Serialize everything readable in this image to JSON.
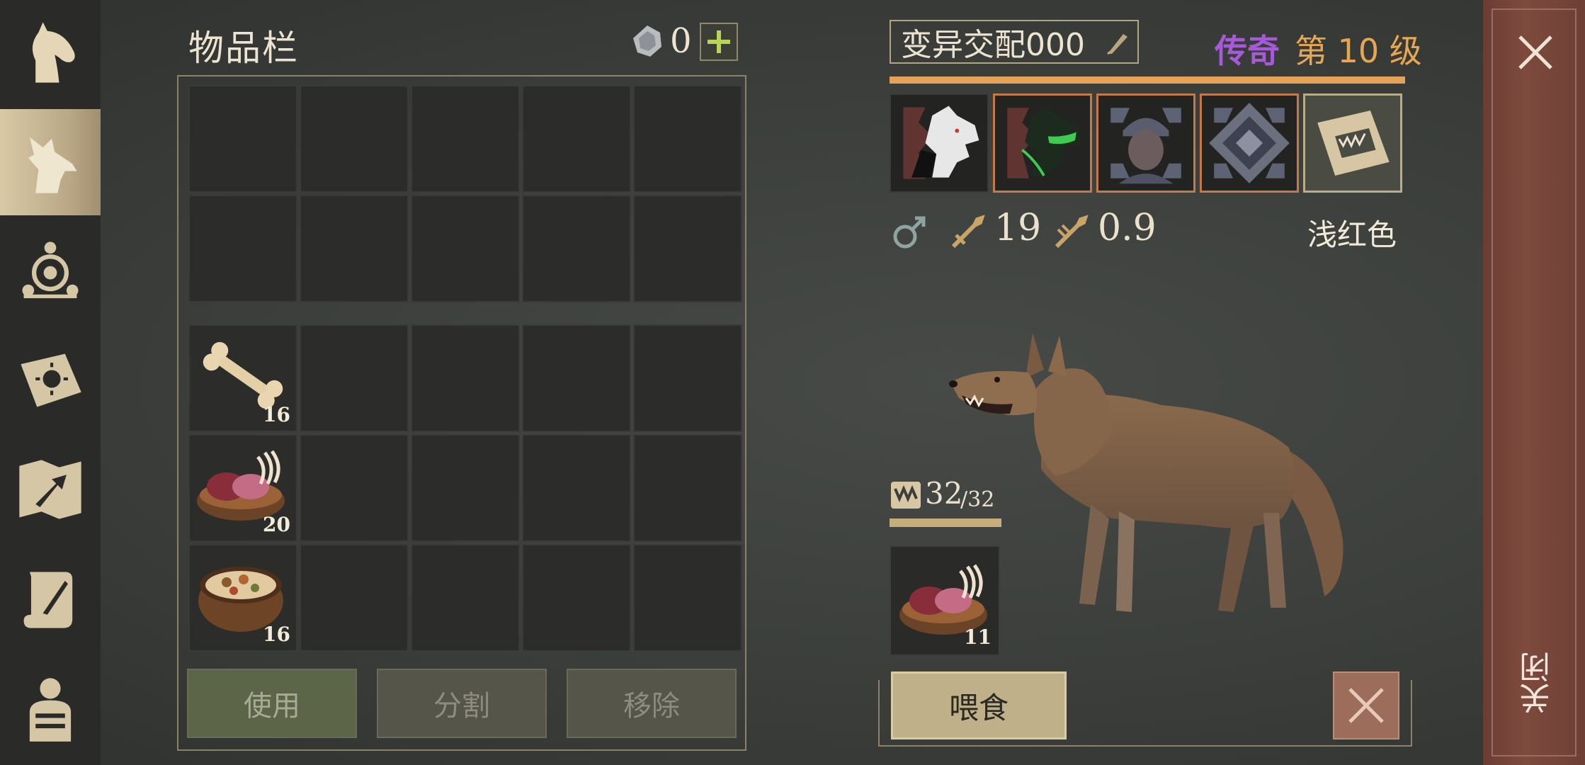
{
  "nav": {
    "items": [
      {
        "icon": "horse-icon",
        "active": false
      },
      {
        "icon": "wolf-icon",
        "active": true
      },
      {
        "icon": "network-icon",
        "active": false
      },
      {
        "icon": "sun-book-icon",
        "active": false
      },
      {
        "icon": "map-arrow-icon",
        "active": false
      },
      {
        "icon": "scroll-quill-icon",
        "active": false
      },
      {
        "icon": "character-icon",
        "active": false
      }
    ]
  },
  "inventory": {
    "title": "物品栏",
    "coins": "0",
    "slots": [
      {
        "row": 0,
        "col": 0,
        "item": "bone-icon",
        "qty": "16"
      },
      {
        "row": 1,
        "col": 0,
        "item": "raw-meat-bowl-icon",
        "qty": "20"
      },
      {
        "row": 2,
        "col": 0,
        "item": "stew-bowl-icon",
        "qty": "16"
      }
    ],
    "buttons": {
      "use": "使用",
      "split": "分割",
      "remove": "移除"
    }
  },
  "pet": {
    "name": "变异交配000",
    "rarity": "传奇",
    "level": "第 10 级",
    "skills": [
      "wolf-head-white-icon",
      "wolf-head-green-icon",
      "soldier-icon",
      "chains-icon",
      "fang-book-icon"
    ],
    "stats": {
      "gender": "male-icon",
      "attack": "19",
      "speed": "0.9"
    },
    "color_name": "浅红色",
    "hunger": {
      "current": "32",
      "max": "/32"
    },
    "food": {
      "item": "raw-meat-bowl-icon",
      "qty": "11"
    },
    "feed_label": "喂食"
  },
  "close_label": "关闭",
  "colors": {
    "rarity": "#a65ad7",
    "level": "#e8a652",
    "accent_bar": "#e5a35a"
  }
}
